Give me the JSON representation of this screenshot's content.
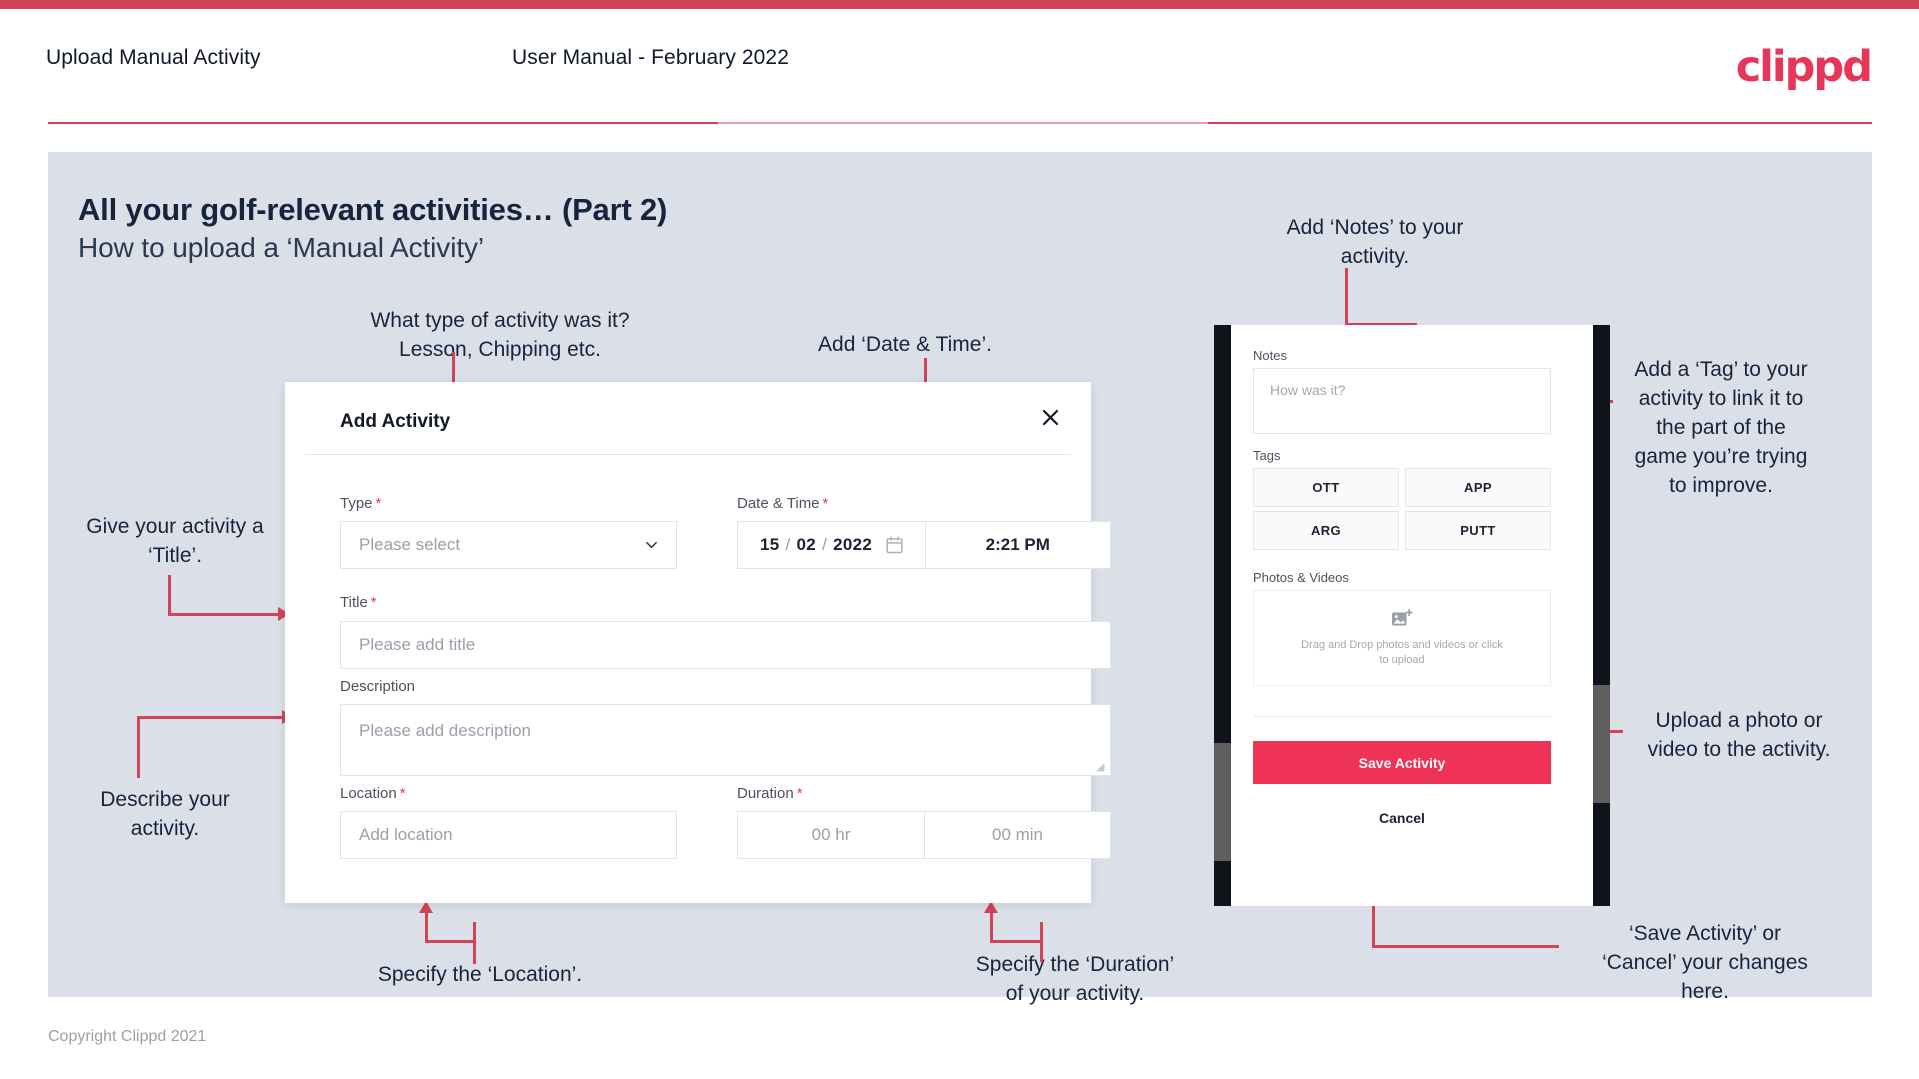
{
  "header": {
    "title": "Upload Manual Activity",
    "subtitle": "User Manual - February 2022",
    "logo": "clippd"
  },
  "slide": {
    "title": "All your golf-relevant activities… (Part 2)",
    "subtitle": "How to upload a ‘Manual Activity’"
  },
  "annotations": {
    "type": "What type of activity was it?\nLesson, Chipping etc.",
    "date_time": "Add ‘Date & Time’.",
    "title": "Give your activity a\n‘Title’.",
    "description": "Describe your\nactivity.",
    "location": "Specify the ‘Location’.",
    "duration": "Specify the ‘Duration’\nof your activity.",
    "notes": "Add ‘Notes’ to your\nactivity.",
    "tag": "Add a ‘Tag’ to your\nactivity to link it to\nthe part of the\ngame you’re trying\nto improve.",
    "upload": "Upload a photo or\nvideo to the activity.",
    "save_cancel": "‘Save Activity’ or\n‘Cancel’ your changes\nhere."
  },
  "dialog": {
    "title": "Add Activity",
    "close_icon": "close-icon",
    "fields": {
      "type": {
        "label": "Type",
        "required": "*",
        "placeholder": "Please select"
      },
      "datetime": {
        "label": "Date & Time",
        "required": "*",
        "day": "15",
        "month": "02",
        "year": "2022",
        "sep": "/",
        "time": "2:21 PM",
        "calendar_icon": "calendar-icon"
      },
      "title": {
        "label": "Title",
        "required": "*",
        "placeholder": "Please add title"
      },
      "description": {
        "label": "Description",
        "placeholder": "Please add description"
      },
      "location": {
        "label": "Location",
        "required": "*",
        "placeholder": "Add location"
      },
      "duration": {
        "label": "Duration",
        "required": "*",
        "hours": "00 hr",
        "minutes": "00 min"
      }
    }
  },
  "phone": {
    "notes": {
      "label": "Notes",
      "placeholder": "How was it?"
    },
    "tags": {
      "label": "Tags",
      "items": [
        "OTT",
        "APP",
        "ARG",
        "PUTT"
      ]
    },
    "photos": {
      "label": "Photos & Videos",
      "dropzone_text": "Drag and Drop photos and videos or click to upload",
      "icon": "add-image-icon"
    },
    "save_label": "Save Activity",
    "cancel_label": "Cancel"
  },
  "footer": {
    "copyright": "Copyright Clippd 2021"
  },
  "colors": {
    "brand_pink": "#E8365B",
    "bar_crimson": "#D24359",
    "save_button": "#EE3357",
    "panel_bg": "#DBE0E8",
    "title_navy": "#16243D"
  }
}
